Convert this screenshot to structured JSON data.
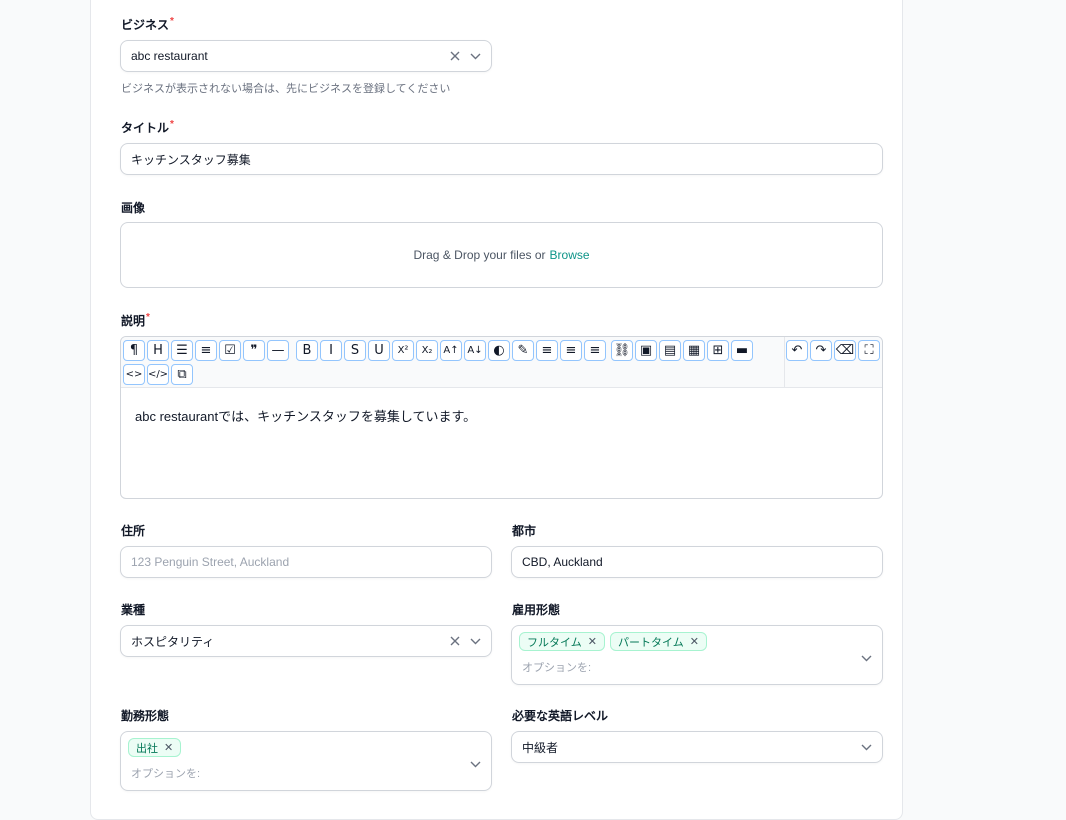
{
  "business": {
    "label": "ビジネス",
    "required_mark": "*",
    "value": "abc restaurant",
    "helper": "ビジネスが表示されない場合は、先にビジネスを登録してください"
  },
  "title": {
    "label": "タイトル",
    "required_mark": "*",
    "value": "キッチンスタッフ募集"
  },
  "image": {
    "label": "画像",
    "drop_text": "Drag & Drop your files or",
    "browse_label": "Browse"
  },
  "description": {
    "label": "説明",
    "required_mark": "*",
    "content": "abc restaurantでは、キッチンスタッフを募集しています。",
    "toolbar": [
      {
        "name": "paragraph",
        "glyph": "¶"
      },
      {
        "name": "heading",
        "glyph": "H"
      },
      {
        "name": "bullet-list",
        "glyph": "☰"
      },
      {
        "name": "ordered-list",
        "glyph": "≡"
      },
      {
        "name": "task-list",
        "glyph": "☑"
      },
      {
        "name": "blockquote",
        "glyph": "❞"
      },
      {
        "name": "horizontal-rule",
        "glyph": "—"
      },
      {
        "name": "bold",
        "glyph": "B"
      },
      {
        "name": "italic",
        "glyph": "I"
      },
      {
        "name": "strikethrough",
        "glyph": "S"
      },
      {
        "name": "underline",
        "glyph": "U"
      },
      {
        "name": "superscript",
        "glyph": "X²"
      },
      {
        "name": "subscript",
        "glyph": "X₂"
      },
      {
        "name": "font-size-up",
        "glyph": "A↑"
      },
      {
        "name": "font-size-down",
        "glyph": "A↓"
      },
      {
        "name": "text-color",
        "glyph": "◐"
      },
      {
        "name": "highlight",
        "glyph": "✎"
      },
      {
        "name": "align-left",
        "glyph": "≡"
      },
      {
        "name": "align-center",
        "glyph": "≡"
      },
      {
        "name": "align-right",
        "glyph": "≡"
      },
      {
        "name": "link",
        "glyph": "⛓"
      },
      {
        "name": "insert-image",
        "glyph": "▣"
      },
      {
        "name": "media",
        "glyph": "▤"
      },
      {
        "name": "table",
        "glyph": "▦"
      },
      {
        "name": "grid-add",
        "glyph": "⊞"
      },
      {
        "name": "details",
        "glyph": "▬"
      },
      {
        "name": "code",
        "glyph": "<>"
      },
      {
        "name": "code-block",
        "glyph": "</>"
      },
      {
        "name": "embed",
        "glyph": "⧉"
      },
      {
        "name": "undo",
        "glyph": "↶"
      },
      {
        "name": "redo",
        "glyph": "↷"
      },
      {
        "name": "clear-formatting",
        "glyph": "⌫"
      },
      {
        "name": "fullscreen",
        "glyph": "⛶"
      }
    ]
  },
  "address": {
    "label": "住所",
    "placeholder": "123 Penguin Street, Auckland"
  },
  "city": {
    "label": "都市",
    "value": "CBD, Auckland"
  },
  "industry": {
    "label": "業種",
    "value": "ホスピタリティ"
  },
  "employment_type": {
    "label": "雇用形態",
    "tags": [
      "フルタイム",
      "パートタイム"
    ],
    "placeholder": "オプションを:"
  },
  "work_style": {
    "label": "勤務形態",
    "tags": [
      "出社"
    ],
    "placeholder": "オプションを:"
  },
  "english_level": {
    "label": "必要な英語レベル",
    "value": "中級者"
  },
  "colors": {
    "accent": "#0d9488",
    "tag_bg": "#ecfdf5",
    "tag_text": "#047857",
    "required": "#ef4444"
  }
}
